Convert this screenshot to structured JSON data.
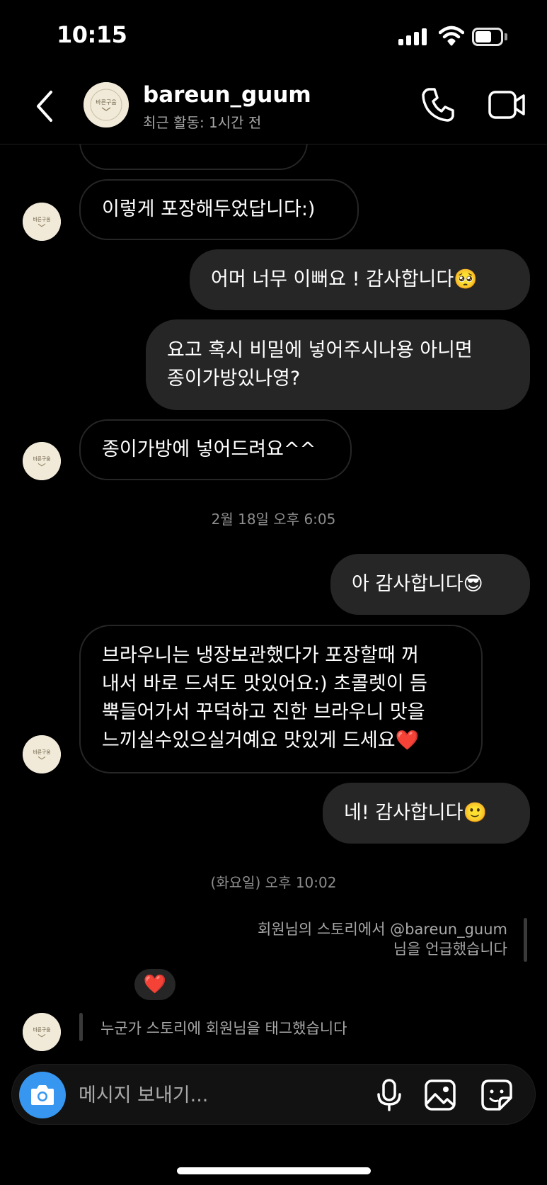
{
  "status_bar": {
    "time": "10:15"
  },
  "header": {
    "username": "bareun_guum",
    "activity": "최근 활동: 1시간 전",
    "avatar_logo_text": "바른구움"
  },
  "messages": [
    {
      "side": "received",
      "text": "이렇게 포장해두었답니다:)"
    },
    {
      "side": "sent",
      "text": "어머 너무 이뻐요 ! 감사합니다🥺"
    },
    {
      "side": "sent",
      "text": "요고 혹시 비밀에 넣어주시나용 아니면\n종이가방있나영?"
    },
    {
      "side": "received",
      "text": "종이가방에 넣어드려요^^"
    },
    {
      "side": "sent",
      "text": "아 감사합니다😎"
    },
    {
      "side": "received",
      "text": "브라우니는 냉장보관했다가 포장할때 꺼\n내서 바로 드셔도 맛있어요:) 초콜렛이 듬\n뿍들어가서 꾸덕하고 진한 브라우니 맛을\n느끼실수있으실거예요 맛있게 드세요❤️"
    },
    {
      "side": "sent",
      "text": "네! 감사합니다🙂"
    }
  ],
  "timestamps": [
    "2월 18일 오후 6:05",
    "(화요일) 오후 10:02"
  ],
  "story_mention": {
    "line1": "회원님의 스토리에서 @bareun_guum",
    "line2": "님을 언급했습니다"
  },
  "reaction": "❤️",
  "story_tag": "누군가 스토리에 회원님을 태그했습니다",
  "composer": {
    "placeholder": "메시지 보내기..."
  },
  "colors": {
    "background": "#000000",
    "sent_bubble": "#262626",
    "received_border": "#262626",
    "secondary_text": "#a8a8a8",
    "camera_button": "#3797f0"
  },
  "icons": [
    "back-chevron-icon",
    "phone-icon",
    "video-camera-icon",
    "camera-icon",
    "microphone-icon",
    "gallery-icon",
    "sticker-icon"
  ]
}
